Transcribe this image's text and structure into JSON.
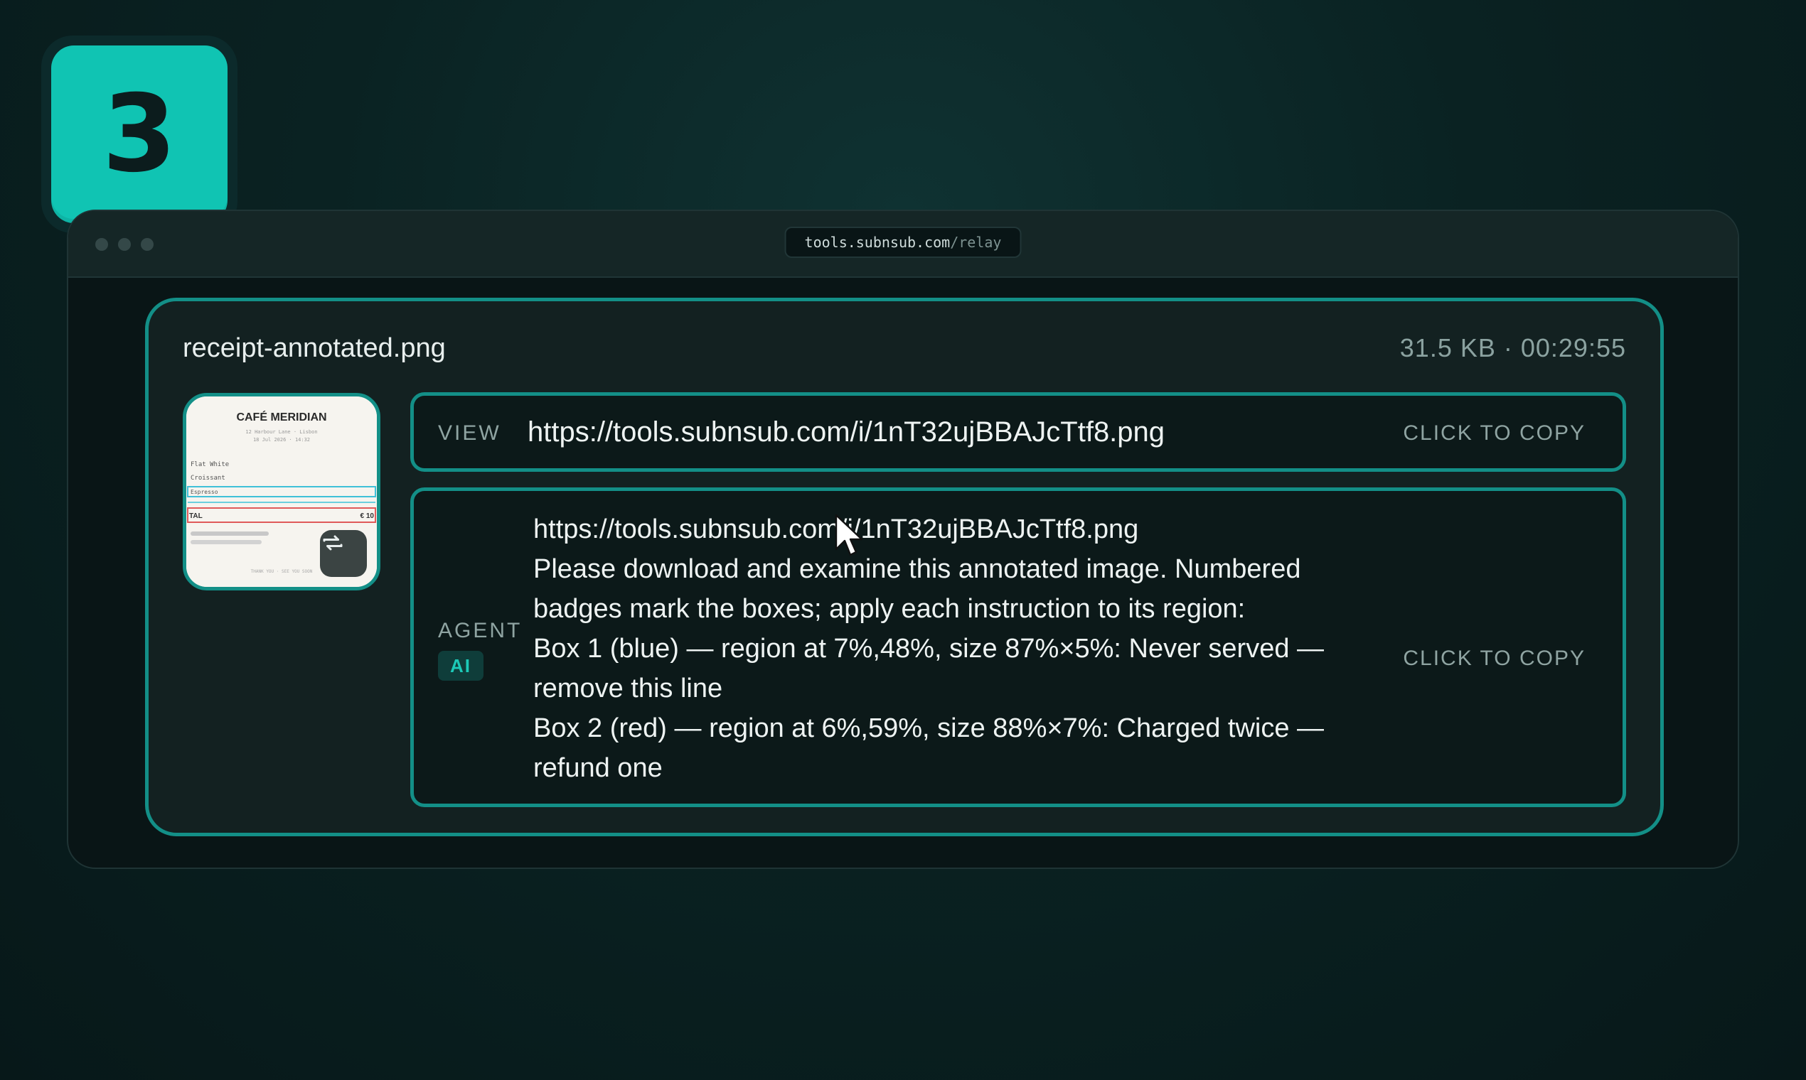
{
  "step": {
    "number": "3"
  },
  "browser": {
    "url_host": "tools.subnsub.com",
    "url_path": "/relay"
  },
  "file": {
    "name": "receipt-annotated.png",
    "meta": "31.5 KB · 00:29:55"
  },
  "thumbnail": {
    "title": "CAFÉ MERIDIAN",
    "address": "12 Harbour Lane · Lisbon",
    "date": "18 Jul 2026 · 14:32",
    "items": [
      "Flat White",
      "Croissant",
      "Espresso"
    ],
    "total_label": "TAL",
    "total_value": "€ 10",
    "footer": "THANK YOU · SEE YOU SOON",
    "icon": "rotate-icon"
  },
  "view_row": {
    "label": "VIEW",
    "url": "https://tools.subnsub.com/i/1nT32ujBBAJcTtf8.png",
    "copy_label": "CLICK TO COPY"
  },
  "agent_row": {
    "label": "AGENT",
    "badge": "AI",
    "copy_label": "CLICK TO COPY",
    "lines": [
      "https://tools.subnsub.com/i/1nT32ujBBAJcTtf8.png",
      "Please download and examine this annotated image. Numbered badges mark the boxes; apply each instruction to its region:",
      "Box 1 (blue) — region at 7%,48%, size 87%×5%: Never served — remove this line",
      "Box 2 (red) — region at 6%,59%, size 88%×7%: Charged twice — refund one"
    ]
  },
  "colors": {
    "accent": "#10c4b3",
    "border": "#138f87",
    "background": "#071819",
    "box1": "#3fc1d8",
    "box2": "#e05a5a"
  }
}
